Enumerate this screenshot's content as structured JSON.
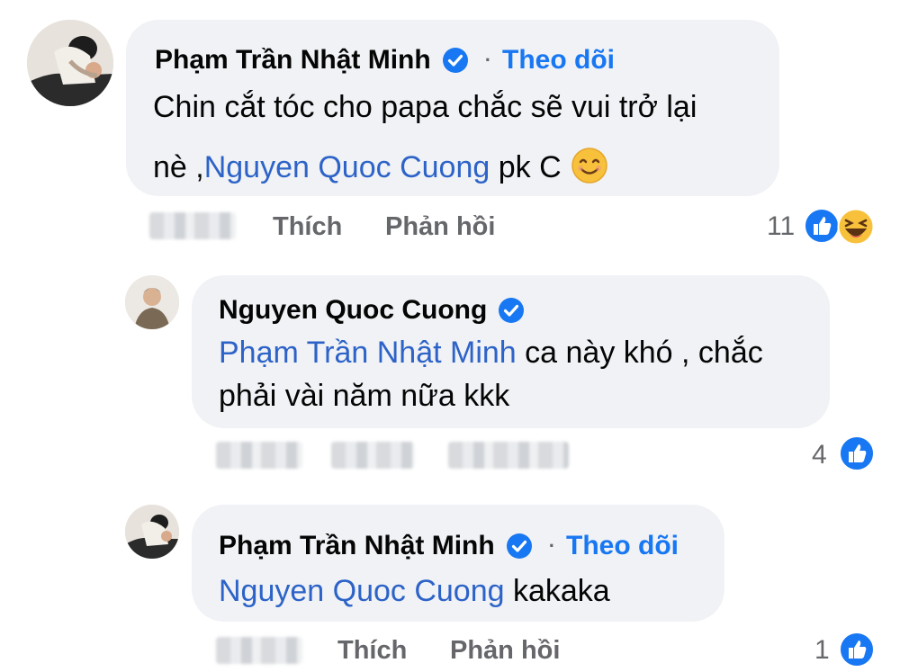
{
  "colors": {
    "bubble": "#f0f2f5",
    "link": "#1877f2",
    "mention": "#2d63c8",
    "muted": "#65676b",
    "verified": "#1877f2"
  },
  "comments": [
    {
      "author": "Phạm Trần Nhật Minh",
      "verified": true,
      "separator": "·",
      "follow_label": "Theo dõi",
      "text_line1": "Chin cắt tóc cho papa chắc sẽ  vui trở lại",
      "text_line2_prefix": "nè ,",
      "mention": "Nguyen Quoc Cuong",
      "text_line2_suffix": " pk C",
      "emoji": "smiling-face-emoji",
      "actions": {
        "like": "Thích",
        "reply": "Phản hồi"
      },
      "reaction_count": "11",
      "reactions": [
        "like-icon",
        "haha-icon"
      ]
    },
    {
      "author": "Nguyen Quoc Cuong",
      "verified": true,
      "mention": "Phạm Trần Nhật Minh",
      "text_line1_suffix": " ca này khó , chắc",
      "text_line2": "phải vài năm nữa kkk",
      "reaction_count": "4",
      "reactions": [
        "like-icon"
      ]
    },
    {
      "author": "Phạm Trần Nhật Minh",
      "verified": true,
      "separator": "·",
      "follow_label": "Theo dõi",
      "mention": "Nguyen Quoc Cuong",
      "text_suffix": " kakaka",
      "actions": {
        "like": "Thích",
        "reply": "Phản hồi"
      },
      "reaction_count": "1",
      "reactions": [
        "like-icon"
      ]
    }
  ]
}
